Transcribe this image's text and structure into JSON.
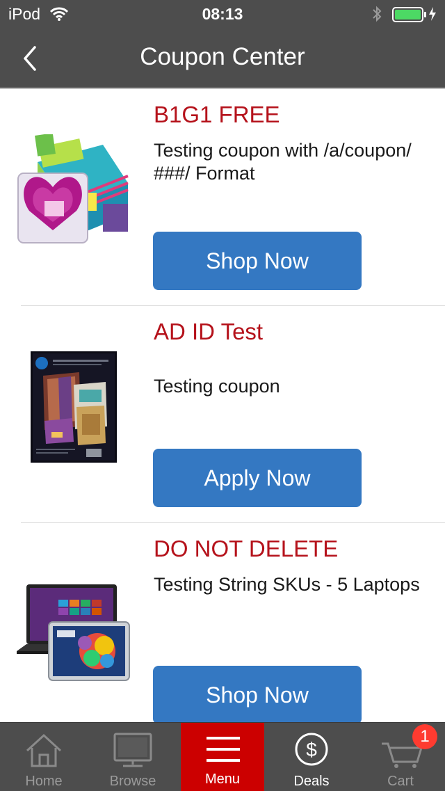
{
  "status_bar": {
    "carrier": "iPod",
    "time": "08:13"
  },
  "header": {
    "title": "Coupon Center"
  },
  "coupons": [
    {
      "title": "B1G1 FREE",
      "description": "Testing coupon with /a/coupon/ ###/ Format",
      "button": "Shop Now",
      "image": "sticky-notes-product"
    },
    {
      "title": "AD ID Test",
      "description": "Testing coupon",
      "button": "Apply Now",
      "image": "hp-brochure-paper-product"
    },
    {
      "title": "DO NOT DELETE",
      "description": "Testing String SKUs - 5 Laptops",
      "button": "Shop Now",
      "image": "laptop-tablet-product"
    }
  ],
  "tab_bar": {
    "items": [
      {
        "label": "Home",
        "icon": "home-icon"
      },
      {
        "label": "Browse",
        "icon": "monitor-icon"
      },
      {
        "label": "Menu",
        "icon": "hamburger-icon"
      },
      {
        "label": "Deals",
        "icon": "dollar-icon"
      },
      {
        "label": "Cart",
        "icon": "cart-icon"
      }
    ],
    "cart_badge": "1"
  },
  "colors": {
    "bar": "#4d4d4d",
    "accent_red": "#cc0000",
    "title_red": "#b5121b",
    "button_blue": "#3478c2"
  }
}
